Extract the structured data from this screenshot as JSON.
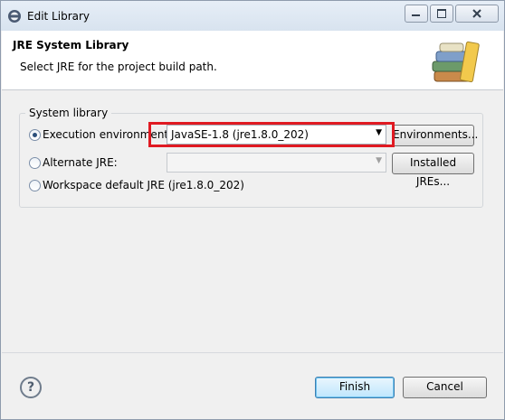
{
  "window": {
    "title": "Edit Library"
  },
  "banner": {
    "title": "JRE System Library",
    "description": "Select JRE for the project build path."
  },
  "group": {
    "label": "System library",
    "options": [
      {
        "label": "Execution environment:",
        "selected": true
      },
      {
        "label": "Alternate JRE:",
        "selected": false
      },
      {
        "label": "Workspace default JRE (jre1.8.0_202)",
        "selected": false
      }
    ],
    "execution_env_value": "JavaSE-1.8 (jre1.8.0_202)",
    "alternate_jre_value": "",
    "environments_button": "Environments...",
    "installed_jres_button": "Installed JREs..."
  },
  "footer": {
    "help": "?",
    "finish": "Finish",
    "cancel": "Cancel"
  },
  "colors": {
    "highlight": "#e01a22",
    "default_button": "#bee6fd"
  }
}
